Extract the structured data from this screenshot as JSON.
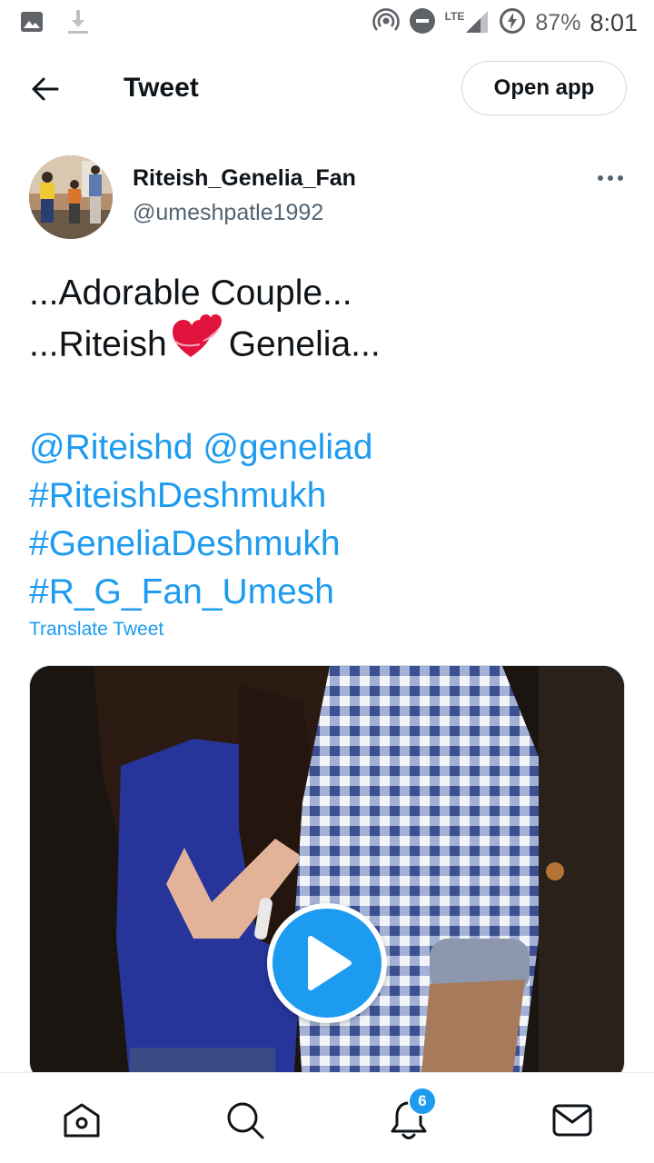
{
  "status_bar": {
    "battery": "87%",
    "time": "8:01",
    "network": "LTE",
    "icons": [
      "gallery-icon",
      "download-icon",
      "hotspot-icon",
      "dnd-icon",
      "signal-icon",
      "battery-saver-icon"
    ]
  },
  "header": {
    "title": "Tweet",
    "open_app_label": "Open app",
    "back_icon": "arrow-left-icon"
  },
  "tweet": {
    "author_name": "Riteish_Genelia_Fan",
    "author_handle": "@umeshpatle1992",
    "line1": "...Adorable Couple...",
    "line2_start": "...Riteish",
    "line2_end": "Genelia...",
    "heart_icon": "two-hearts-emoji",
    "mentions": "@Riteishd @geneliad",
    "hashtag1": "#RiteishDeshmukh",
    "hashtag2": "#GeneliaDeshmukh",
    "hashtag3": "#R_G_Fan_Umesh",
    "translate_label": "Translate Tweet"
  },
  "media": {
    "type": "video",
    "play_icon": "play-icon"
  },
  "bottom_nav": {
    "items": [
      "home-icon",
      "search-icon",
      "notifications-icon",
      "messages-icon"
    ],
    "notification_count": "6"
  },
  "colors": {
    "accent": "#1d9bf0",
    "text": "#0f1419",
    "secondary": "#536471"
  }
}
